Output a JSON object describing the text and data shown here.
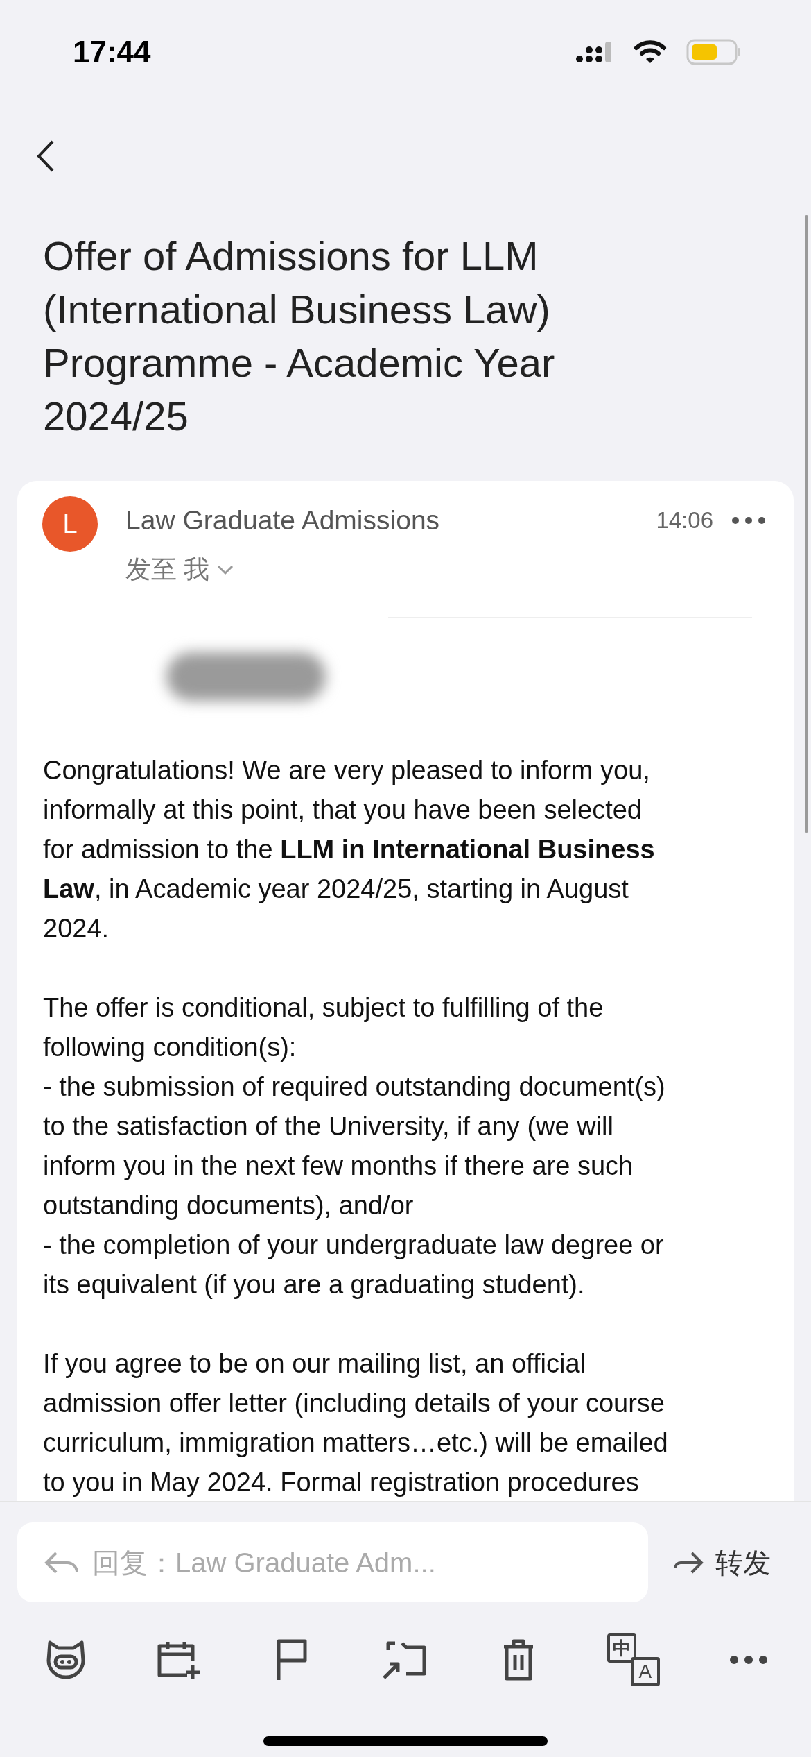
{
  "status_bar": {
    "time": "17:44"
  },
  "subject": "Offer of Admissions for LLM (International Business Law) Programme - Academic Year 2024/25",
  "message": {
    "avatar_letter": "L",
    "sender": "Law Graduate Admissions",
    "time": "14:06",
    "recipient": "发至 我",
    "body": [
      {
        "kind": "paragraph",
        "lines": [
          "Congratulations! We are very pleased to inform you,",
          "informally at this point, that you have been selected",
          "for admission to the **LLM in International Business**",
          "**Law**, in Academic year 2024/25, starting in August",
          "2024."
        ]
      },
      {
        "kind": "paragraph",
        "lines": [
          "The offer is conditional, subject to fulfilling of the",
          "following condition(s):"
        ]
      },
      {
        "kind": "item",
        "lines": [
          "- the submission of required outstanding document(s)",
          "to the satisfaction of the University, if any (we will",
          "inform you in the next few months if there are such",
          "outstanding documents), and/or"
        ]
      },
      {
        "kind": "item",
        "lines": [
          "- the completion of your undergraduate law degree or",
          "its equivalent (if you are a graduating student)."
        ]
      },
      {
        "kind": "paragraph",
        "lines": [
          "If you agree to be on our mailing list, an official",
          "admission offer letter (including details of your course",
          "curriculum, immigration matters…etc.) will be emailed",
          "to you in May 2024. Formal registration procedures"
        ]
      }
    ]
  },
  "reply_bar": {
    "placeholder": "回复：Law Graduate Adm...",
    "forward": "转发"
  },
  "toolbar": [
    {
      "kind": "pig"
    },
    {
      "kind": "calendar"
    },
    {
      "kind": "flag"
    },
    {
      "kind": "move"
    },
    {
      "kind": "trash"
    },
    {
      "kind": "translate",
      "glyphs": [
        "中",
        "A"
      ]
    },
    {
      "kind": "more"
    }
  ]
}
